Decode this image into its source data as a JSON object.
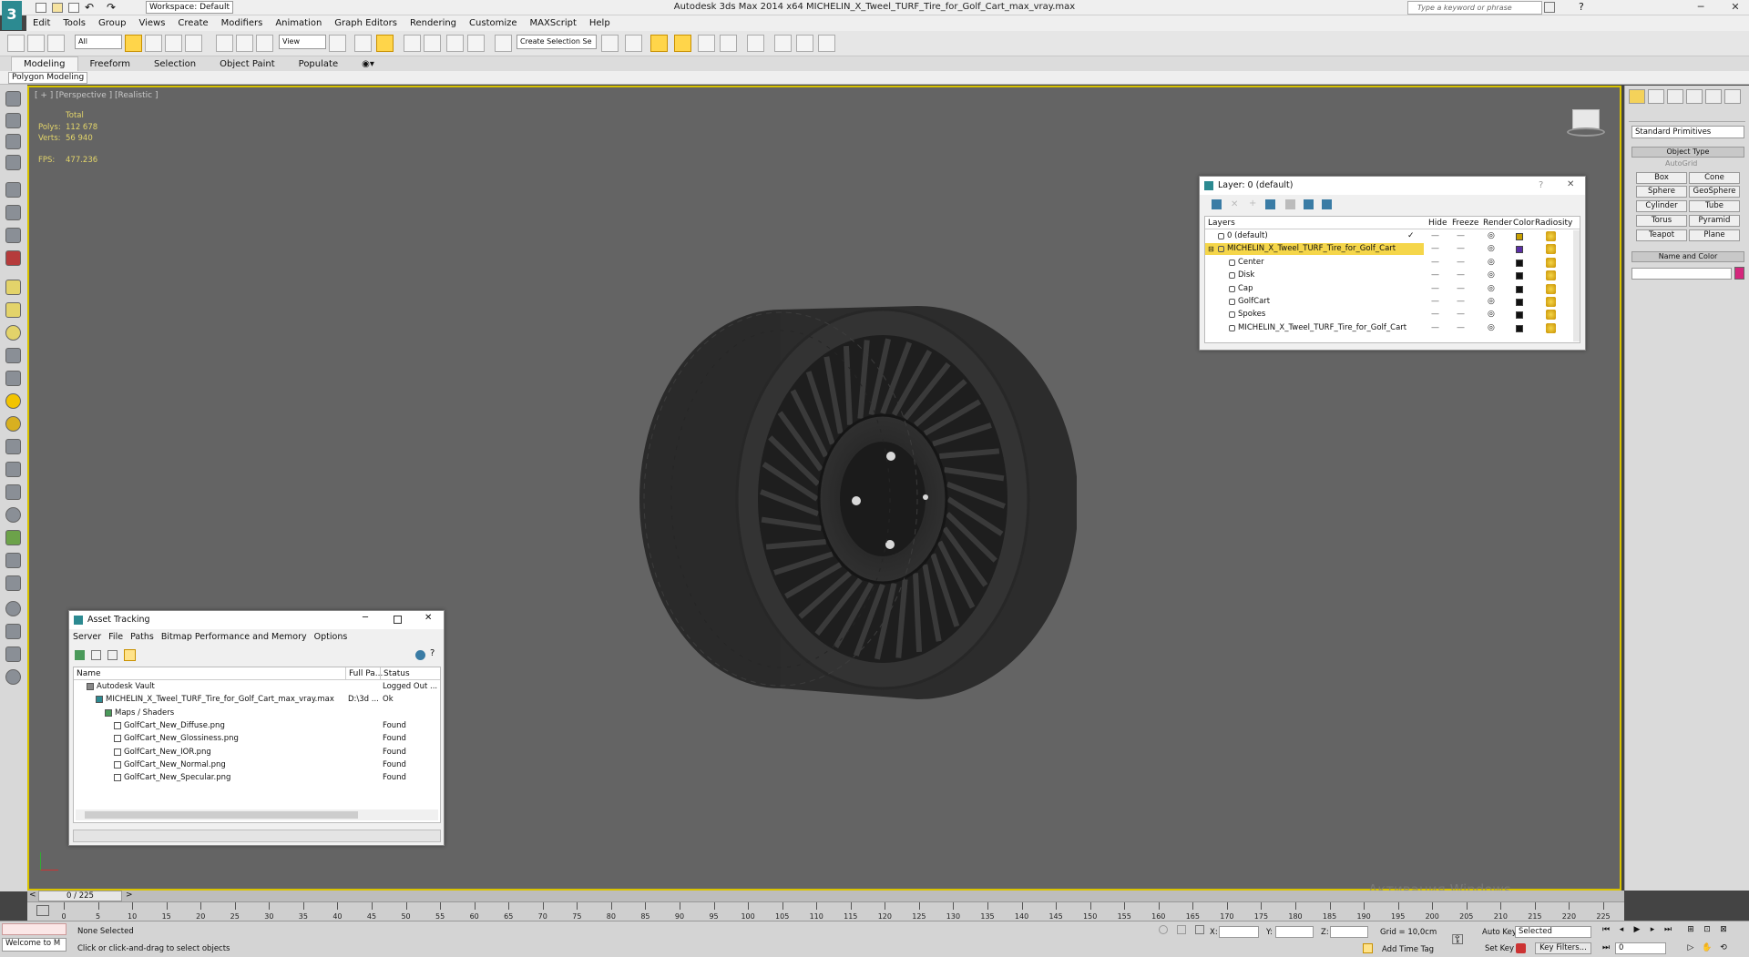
{
  "app": {
    "title": "Autodesk 3ds Max  2014 x64     MICHELIN_X_Tweel_TURF_Tire_for_Golf_Cart_max_vray.max",
    "workspace": "Workspace: Default",
    "search_placeholder": "Type a keyword or phrase",
    "win_min": "─",
    "win_max": "❐",
    "win_close": "✕"
  },
  "menu": [
    "Edit",
    "Tools",
    "Group",
    "Views",
    "Create",
    "Modifiers",
    "Animation",
    "Graph Editors",
    "Rendering",
    "Customize",
    "MAXScript",
    "Help"
  ],
  "toolbar": {
    "filter": "All",
    "ref_coord": "View",
    "selection_set": "Create Selection Se"
  },
  "ribbon": {
    "tabs": [
      "Modeling",
      "Freeform",
      "Selection",
      "Object Paint",
      "Populate"
    ],
    "subtab": "Polygon Modeling"
  },
  "viewport": {
    "label": "[ + ] [Perspective ] [Realistic ]",
    "total": "Total",
    "polys_label": "Polys:",
    "polys": "112 678",
    "verts_label": "Verts:",
    "verts": "56 940",
    "fps_label": "FPS:",
    "fps": "477.236",
    "watermark": "Активация Windows"
  },
  "command_panel": {
    "category": "Standard Primitives",
    "object_type": "Object Type",
    "autogrid": "AutoGrid",
    "buttons": [
      "Box",
      "Cone",
      "Sphere",
      "GeoSphere",
      "Cylinder",
      "Tube",
      "Torus",
      "Pyramid",
      "Teapot",
      "Plane"
    ],
    "name_color": "Name and Color"
  },
  "layer_dialog": {
    "title": "Layer: 0 (default)",
    "question": "?",
    "close": "✕",
    "headers": {
      "layers": "Layers",
      "hide": "Hide",
      "freeze": "Freeze",
      "render": "Render",
      "color": "Color",
      "radiosity": "Radiosity"
    },
    "rows": [
      {
        "name": "0 (default)",
        "color": "#c8a000"
      },
      {
        "name": "MICHELIN_X_Tweel_TURF_Tire_for_Golf_Cart",
        "color": "#5a2ea6"
      },
      {
        "name": "Center",
        "color": "#111111"
      },
      {
        "name": "Disk",
        "color": "#111111"
      },
      {
        "name": "Cap",
        "color": "#111111"
      },
      {
        "name": "GolfCart",
        "color": "#111111"
      },
      {
        "name": "Spokes",
        "color": "#111111"
      },
      {
        "name": "MICHELIN_X_Tweel_TURF_Tire_for_Golf_Cart",
        "color": "#111111"
      }
    ]
  },
  "asset_dialog": {
    "title": "Asset Tracking",
    "menu": [
      "Server",
      "File",
      "Paths",
      "Bitmap Performance and Memory",
      "Options"
    ],
    "headers": {
      "name": "Name",
      "path": "Full Pa...",
      "status": "Status"
    },
    "rows": [
      {
        "name": "Autodesk Vault",
        "path": "",
        "status": "Logged Out ..."
      },
      {
        "name": "MICHELIN_X_Tweel_TURF_Tire_for_Golf_Cart_max_vray.max",
        "path": "D:\\3d ...",
        "status": "Ok"
      },
      {
        "name": "Maps / Shaders",
        "path": "",
        "status": ""
      },
      {
        "name": "GolfCart_New_Diffuse.png",
        "path": "",
        "status": "Found"
      },
      {
        "name": "GolfCart_New_Glossiness.png",
        "path": "",
        "status": "Found"
      },
      {
        "name": "GolfCart_New_IOR.png",
        "path": "",
        "status": "Found"
      },
      {
        "name": "GolfCart_New_Normal.png",
        "path": "",
        "status": "Found"
      },
      {
        "name": "GolfCart_New_Specular.png",
        "path": "",
        "status": "Found"
      }
    ]
  },
  "timeline": {
    "counter": "0 / 225",
    "ticks": [
      "0",
      "5",
      "10",
      "15",
      "20",
      "25",
      "30",
      "35",
      "40",
      "45",
      "50",
      "55",
      "60",
      "65",
      "70",
      "75",
      "80",
      "85",
      "90",
      "95",
      "100",
      "105",
      "110",
      "115",
      "120",
      "125",
      "130",
      "135",
      "140",
      "145",
      "150",
      "155",
      "160",
      "165",
      "170",
      "175",
      "180",
      "185",
      "190",
      "195",
      "200",
      "205",
      "210",
      "215",
      "220",
      "225"
    ]
  },
  "status": {
    "welcome": "Welcome to M",
    "selection": "None Selected",
    "prompt": "Click or click-and-drag to select objects",
    "x": "X:",
    "y": "Y:",
    "z": "Z:",
    "grid": "Grid = 10,0cm",
    "add_time_tag": "Add Time Tag",
    "auto_key": "Auto Key",
    "selected": "Selected",
    "set_key": "Set Key",
    "key_filters": "Key Filters...",
    "frame": "0"
  }
}
